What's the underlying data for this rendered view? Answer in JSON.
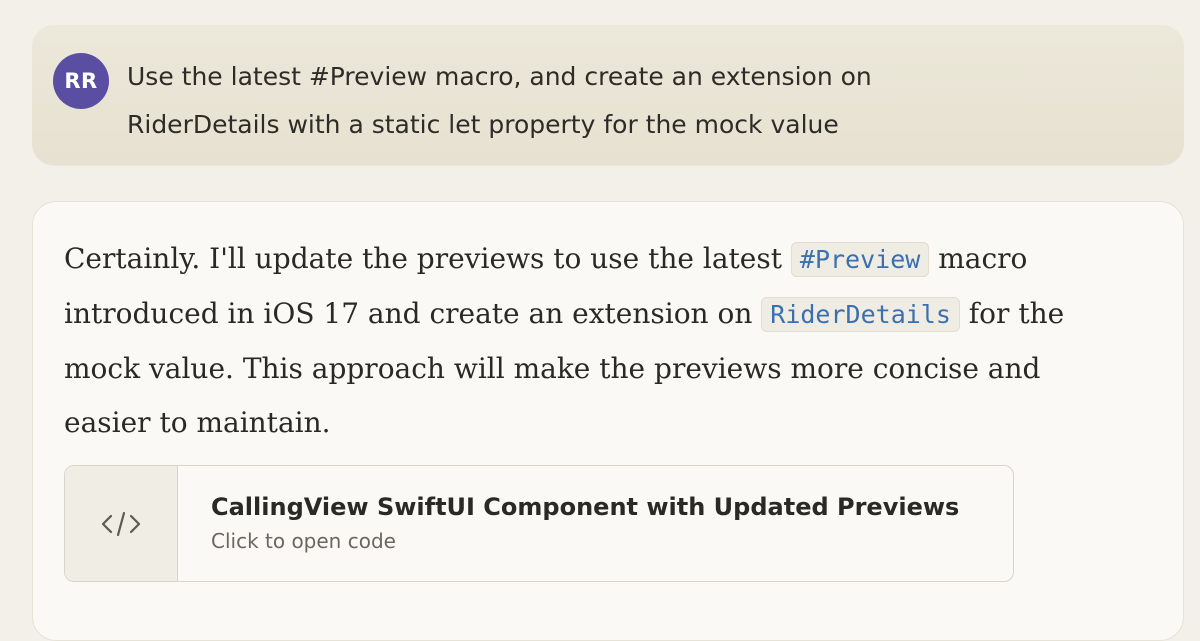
{
  "user_message": {
    "avatar_initials": "RR",
    "avatar_color": "#5a4ea3",
    "text_line1": "Use the latest #Preview macro, and create an extension on",
    "text_line2": "RiderDetails with a static let property for the mock value"
  },
  "assistant_message": {
    "seg1": "Certainly. I'll update the previews to use the latest ",
    "code1": "#Preview",
    "seg2": " macro introduced in iOS 17 and create an extension on ",
    "code2": "RiderDetails",
    "seg3": " for the mock value. This approach will make the previews more concise and easier to maintain."
  },
  "artifact": {
    "icon": "code-brackets-icon",
    "title": "CallingView SwiftUI Component with Updated Previews",
    "subtitle": "Click to open code"
  },
  "colors": {
    "background": "#f2f0e8",
    "user_bubble": "#e8e4d4",
    "assistant_bubble": "#faf9f6",
    "inline_code": "#3a6fb0"
  }
}
